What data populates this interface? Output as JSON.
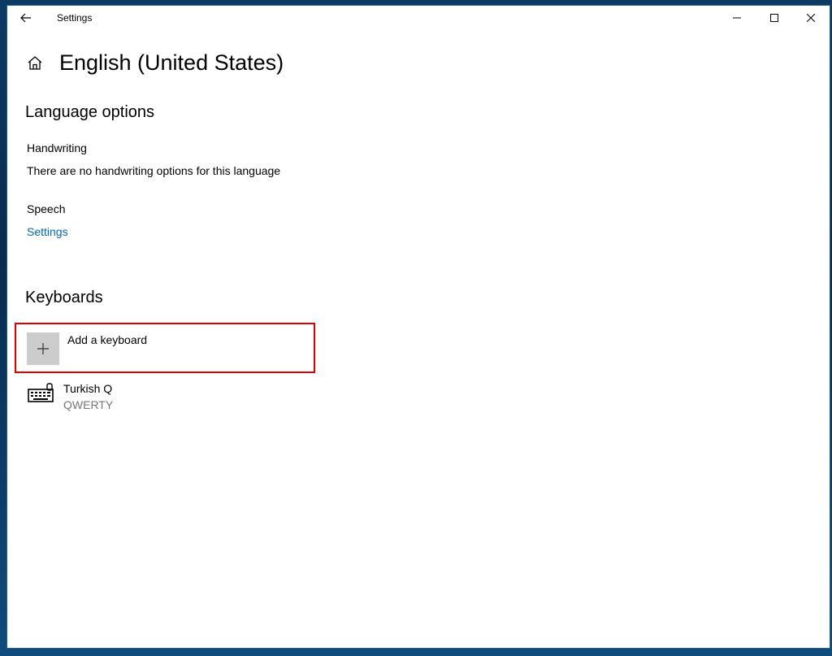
{
  "window": {
    "title": "Settings"
  },
  "page": {
    "title": "English (United States)"
  },
  "language_options": {
    "heading": "Language options",
    "handwriting_label": "Handwriting",
    "handwriting_text": "There are no handwriting options for this language",
    "speech_label": "Speech",
    "speech_link": "Settings"
  },
  "keyboards": {
    "heading": "Keyboards",
    "add_label": "Add a keyboard",
    "items": [
      {
        "name": "Turkish Q",
        "layout": "QWERTY",
        "icon": "keyboard-icon"
      }
    ]
  },
  "icons": {
    "back": "back-arrow-icon",
    "home": "home-icon",
    "minimize": "minimize-icon",
    "maximize": "maximize-icon",
    "close": "close-icon",
    "add": "plus-icon"
  },
  "colors": {
    "accent_link": "#0067b8",
    "highlight_border": "#e00000",
    "secondary_text": "#767676",
    "plus_box": "#cccccc"
  }
}
